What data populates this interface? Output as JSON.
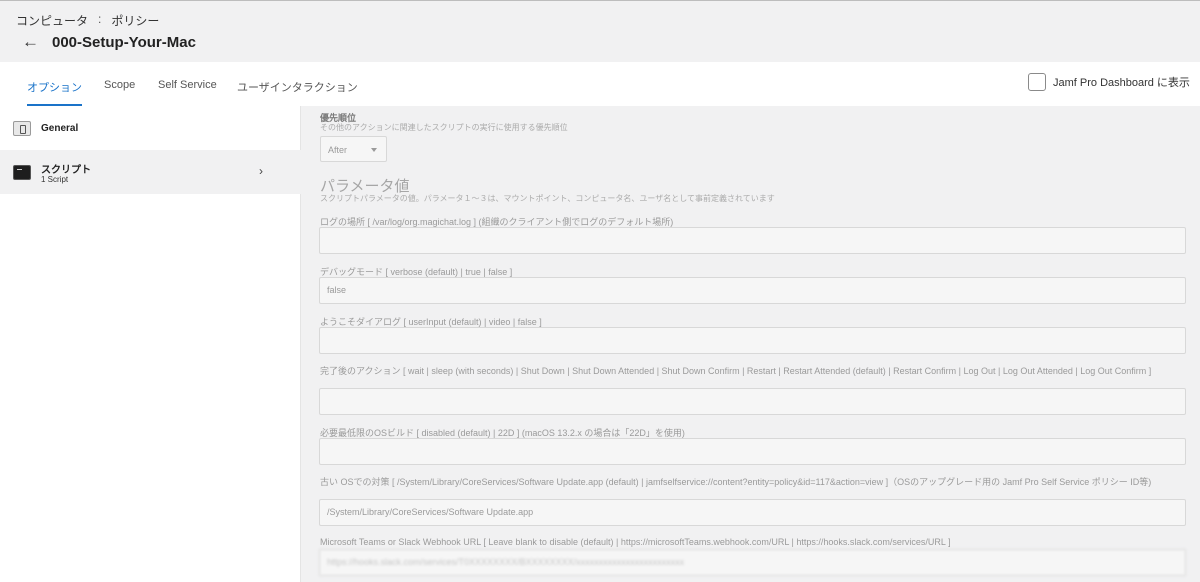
{
  "breadcrumb": {
    "parent": "コンピュータ",
    "separator": ":",
    "current": "ポリシー"
  },
  "page": {
    "title": "000-Setup-Your-Mac"
  },
  "tabs": [
    {
      "label": "オプション"
    },
    {
      "label": "Scope"
    },
    {
      "label": "Self Service"
    },
    {
      "label": "ユーザインタラクション"
    }
  ],
  "dashboard_toggle": {
    "label": "Jamf Pro Dashboard に表示",
    "checked": false
  },
  "sidebar": {
    "items": [
      {
        "label": "General",
        "icon": "general-icon"
      },
      {
        "label": "スクリプト",
        "sub": "1 Script",
        "icon": "script-icon"
      }
    ]
  },
  "priority": {
    "label": "優先順位",
    "hint": "その他のアクションに関連したスクリプトの実行に使用する優先順位",
    "value": "After"
  },
  "parameters": {
    "title": "パラメータ値",
    "hint": "スクリプトパラメータの値。パラメータ１〜３は、マウントポイント、コンピュータ名、ユーザ名として事前定義されています",
    "fields": [
      {
        "label": "ログの場所 [ /var/log/org.magichat.log ] (組織のクライアント側でログのデフォルト場所)",
        "value": ""
      },
      {
        "label": "デバッグモード [ verbose (default) | true | false ]",
        "value": "false"
      },
      {
        "label": "ようこそダイアログ [ userInput (default) | video | false ]",
        "value": ""
      },
      {
        "label": "完了後のアクション [ wait | sleep (with seconds) | Shut Down | Shut Down Attended | Shut Down Confirm | Restart | Restart Attended (default) | Restart Confirm | Log Out | Log Out Attended | Log Out Confirm ]",
        "value": ""
      },
      {
        "label": "必要最低限のOSビルド [ disabled (default) | 22D ] (macOS 13.2.x の場合は「22D」を使用)",
        "value": ""
      },
      {
        "label": "古い OSでの対策 [ /System/Library/CoreServices/Software Update.app (default) | jamfselfservice://content?entity=policy&id=117&action=view ]（OSのアップグレード用の Jamf Pro Self Service ポリシー ID等)",
        "value": "/System/Library/CoreServices/Software Update.app"
      },
      {
        "label": "Microsoft Teams or Slack Webhook URL [ Leave blank to disable (default) | https://microsoftTeams.webhook.com/URL | https://hooks.slack.com/services/URL ]",
        "value": "https://hooks.slack.com/services/T0XXXXXXXX/BXXXXXXXX/xxxxxxxxxxxxxxxxxxxxxxxx"
      }
    ]
  }
}
